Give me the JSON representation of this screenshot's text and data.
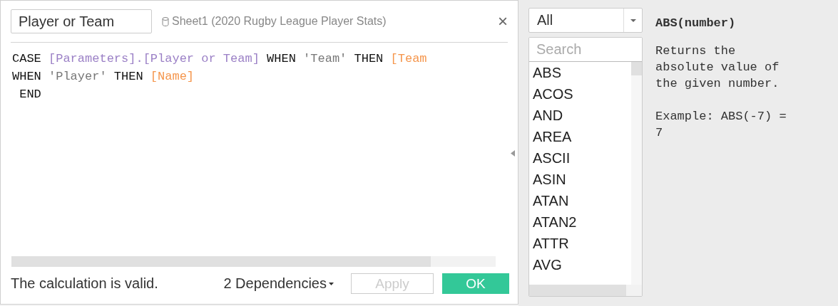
{
  "editor": {
    "name_field": {
      "value": "Player or Team"
    },
    "source": "Sheet1 (2020 Rugby League Player Stats)",
    "close": "×",
    "code_lines": [
      [
        {
          "kind": "keyword",
          "text": "CASE "
        },
        {
          "kind": "parameter",
          "text": "[Parameters].[Player or Team]"
        },
        {
          "kind": "keyword",
          "text": " WHEN "
        },
        {
          "kind": "string",
          "text": "'Team'"
        },
        {
          "kind": "keyword",
          "text": " THEN "
        },
        {
          "kind": "field",
          "text": "[Team"
        }
      ],
      [
        {
          "kind": "keyword",
          "text": "WHEN "
        },
        {
          "kind": "string",
          "text": "'Player'"
        },
        {
          "kind": "keyword",
          "text": " THEN "
        },
        {
          "kind": "field",
          "text": "[Name]"
        }
      ],
      [
        {
          "kind": "keyword",
          "text": " END"
        }
      ]
    ],
    "status": "The calculation is valid.",
    "dependencies": "2 Dependencies",
    "apply": {
      "label": "Apply",
      "disabled": true
    },
    "ok": "OK"
  },
  "functions": {
    "category": "All",
    "search": {
      "placeholder": "Search"
    },
    "items": [
      {
        "label": "ABS"
      },
      {
        "label": "ACOS"
      },
      {
        "label": "AND"
      },
      {
        "label": "AREA"
      },
      {
        "label": "ASCII"
      },
      {
        "label": "ASIN"
      },
      {
        "label": "ATAN"
      },
      {
        "label": "ATAN2"
      },
      {
        "label": "ATTR"
      },
      {
        "label": "AVG"
      }
    ],
    "help": {
      "signature": "ABS(number)",
      "description": "Returns the absolute value of the given number.",
      "example": "Example: ABS(-7) = 7"
    }
  }
}
